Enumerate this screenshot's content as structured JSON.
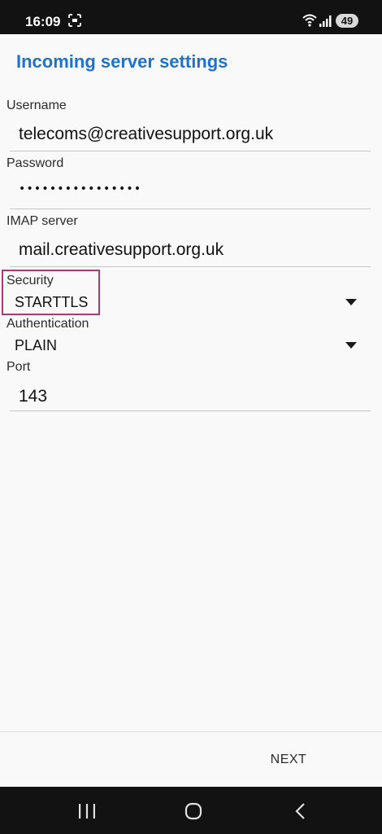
{
  "status_bar": {
    "time": "16:09",
    "battery": "49",
    "icons": [
      "screenshot-icon",
      "wifi-icon",
      "signal-icon",
      "battery-icon"
    ]
  },
  "page": {
    "title": "Incoming server settings",
    "accent_color": "#1e73c8"
  },
  "fields": {
    "username": {
      "label": "Username",
      "value": "telecoms@creativesupport.org.uk"
    },
    "password": {
      "label": "Password",
      "value": "••••••••••••••••"
    },
    "imap_server": {
      "label": "IMAP server",
      "value": "mail.creativesupport.org.uk"
    },
    "security": {
      "label": "Security",
      "value": "STARTTLS",
      "highlight_color": "#b0377a"
    },
    "authentication": {
      "label": "Authentication",
      "value": "PLAIN"
    },
    "port": {
      "label": "Port",
      "value": "143"
    }
  },
  "actions": {
    "next_label": "NEXT"
  },
  "nav_bar": {
    "icons": [
      "recents-icon",
      "home-icon",
      "back-icon"
    ]
  }
}
